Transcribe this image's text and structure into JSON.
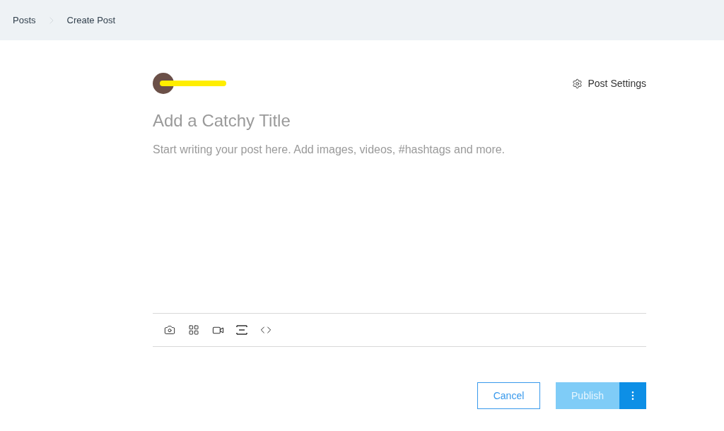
{
  "breadcrumb": [
    {
      "label": "Posts"
    },
    {
      "label": "Create Post"
    }
  ],
  "editor": {
    "settings_label": "Post Settings",
    "title_placeholder": "Add a Catchy Title",
    "body_placeholder": "Start writing your post here. Add images, videos, #hashtags and more."
  },
  "toolbar": [
    {
      "kind": "photo"
    },
    {
      "kind": "gallery"
    },
    {
      "kind": "video"
    },
    {
      "kind": "divider"
    },
    {
      "kind": "html"
    }
  ],
  "actions": {
    "cancel": "Cancel",
    "publish": {
      "label": "Publish",
      "disabled": true
    }
  }
}
